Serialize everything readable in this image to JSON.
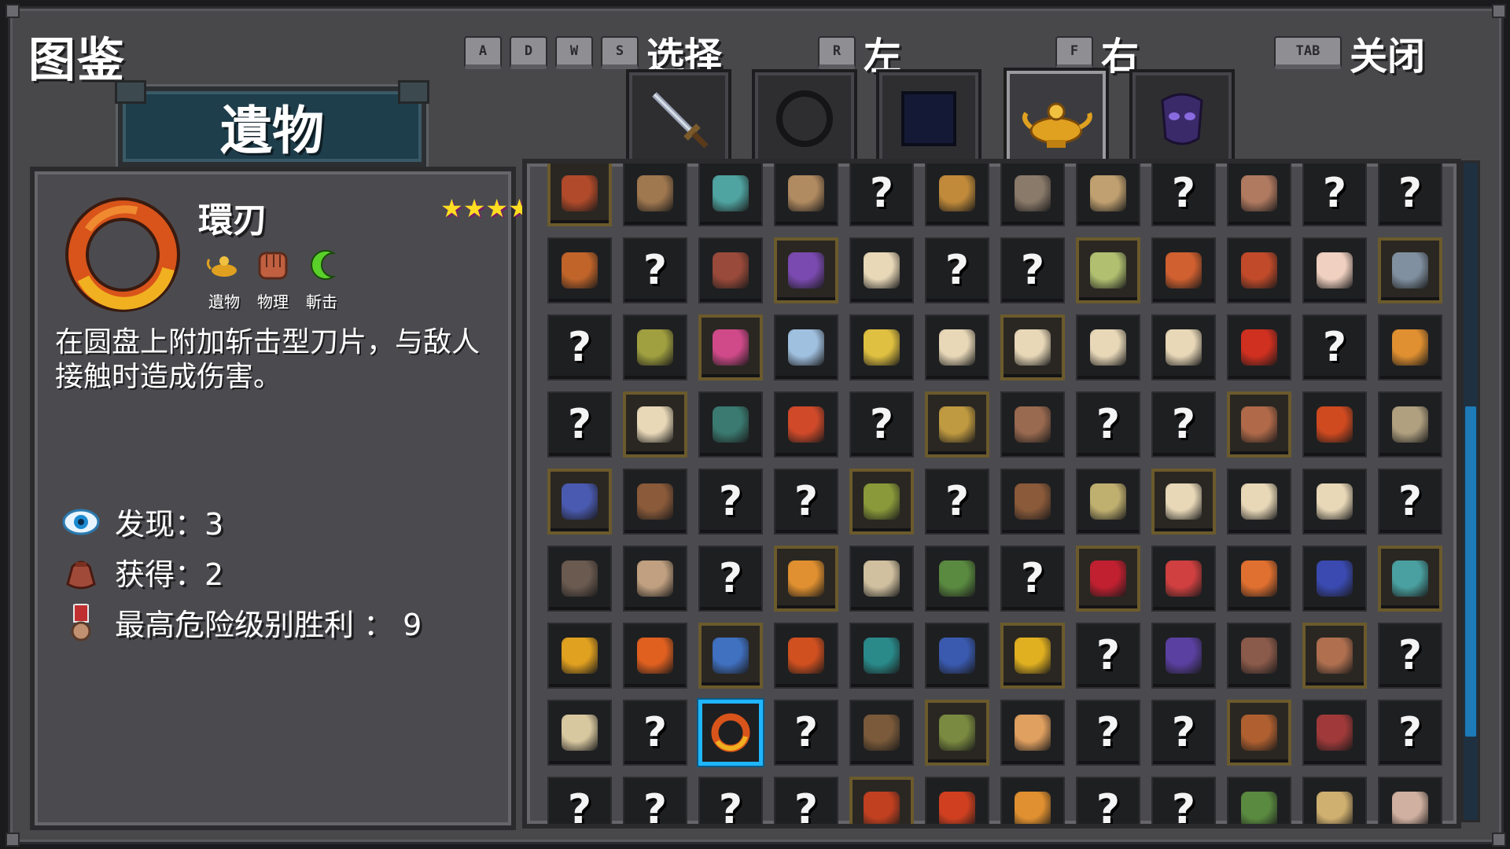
{
  "title": "图鉴",
  "hints": {
    "select_keys": [
      "A",
      "D",
      "W",
      "S"
    ],
    "select_label": "选择",
    "left_key": "R",
    "left_label": "左",
    "right_key": "F",
    "right_label": "右",
    "close_key": "TAB",
    "close_label": "关闭"
  },
  "category": "遺物",
  "tabs": [
    {
      "icon": "sword-icon"
    },
    {
      "icon": "ring-icon"
    },
    {
      "icon": "dark-square-icon"
    },
    {
      "icon": "genie-lamp-icon",
      "active": true
    },
    {
      "icon": "purple-mask-icon"
    }
  ],
  "detail": {
    "name": "環刃",
    "stars": "★★★★",
    "tags": [
      "遺物",
      "物理",
      "斬击"
    ],
    "description": "在圆盘上附加斩击型刀片，与敌人接触时造成伤害。",
    "stats": [
      {
        "icon": "eye-icon",
        "label": "发现：3"
      },
      {
        "icon": "bag-icon",
        "label": "获得：2"
      },
      {
        "icon": "medal-icon",
        "label": "最高危险级别胜利 ： 9"
      }
    ]
  },
  "unknown_glyph": "?",
  "colors": {
    "frame": "#48484b",
    "banner": "#1f3e4c",
    "selection": "#1fb6ff",
    "scroll_thumb": "#1d7bb8",
    "star": "#ffdd22",
    "gold_border": "#6b5a2c"
  },
  "grid": [
    [
      "i:#b04a2a",
      "i:#a07850",
      "i:#4fa3a0",
      "i:#b08a60",
      "?",
      "i:#c08a3a",
      "i:#8a7a6a",
      "i:#c0a070",
      "?",
      "i:#b07a60",
      "?",
      "?"
    ],
    [
      "i:#c0642a",
      "?",
      "i:#9a4a3a",
      "i:#7a4ab0",
      "i:#e8d8b8",
      "?",
      "?",
      "i:#b0c070",
      "i:#d06030",
      "i:#c04a2a",
      "i:#f0d0c0",
      "i:#8090a0"
    ],
    [
      "?",
      "i:#a0a040",
      "i:#d04a8a",
      "i:#a0c0e0",
      "i:#e0c040",
      "i:#e8d8b8",
      "i:#e8d8b8",
      "i:#e8d8b8",
      "i:#e8d8b8",
      "i:#d03020",
      "?",
      "i:#e09030"
    ],
    [
      "?",
      "i:#e8d8b8",
      "i:#3a7a70",
      "i:#d04a2a",
      "?",
      "i:#c09a40",
      "i:#9a6a50",
      "?",
      "?",
      "i:#b06a4a",
      "i:#d04a20",
      "i:#b0a080"
    ],
    [
      "i:#4a5ab0",
      "i:#8a5a3a",
      "?",
      "?",
      "i:#8a9a3a",
      "?",
      "i:#8a5a3a",
      "i:#c0b070",
      "i:#e8d8b8",
      "i:#e8d8b8",
      "i:#e8d8b8",
      "?"
    ],
    [
      "i:#6a5a50",
      "i:#c0a080",
      "?",
      "i:#e09030",
      "i:#d0c0a0",
      "i:#5a8a40",
      "?",
      "i:#c02030",
      "i:#d04040",
      "i:#e07030",
      "i:#3a4ab0",
      "i:#4aa0a0"
    ],
    [
      "i:#e0a020",
      "i:#e06020",
      "i:#4070c0",
      "i:#d05020",
      "i:#2a8a8a",
      "i:#3a5ab0",
      "i:#e0b020",
      "?",
      "i:#5a40a0",
      "i:#8a5a4a",
      "i:#b07050",
      "?"
    ],
    [
      "i:#d8c8a0",
      "?",
      "sel",
      "?",
      "i:#7a5a3a",
      "i:#7a8a40",
      "i:#e0a060",
      "?",
      "?",
      "i:#b06030",
      "i:#a03a3a",
      "?"
    ],
    [
      "?",
      "?",
      "?",
      "?",
      "i:#c04020",
      "i:#d04020",
      "i:#e09030",
      "?",
      "?",
      "i:#5a8a40",
      "i:#d0b070",
      "i:#d0b0a0"
    ]
  ]
}
